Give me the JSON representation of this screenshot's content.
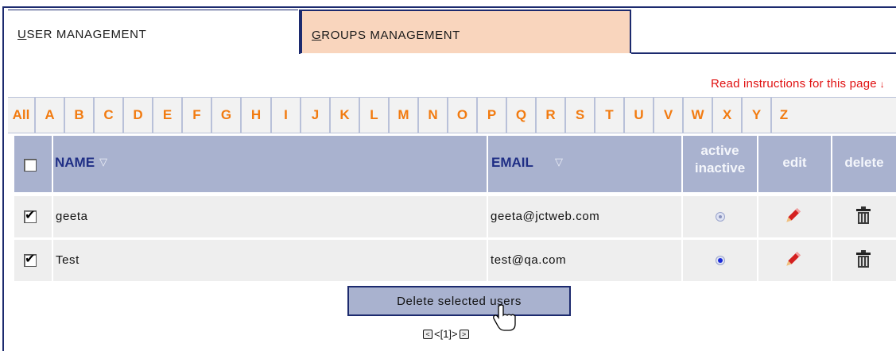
{
  "tabs": {
    "user": {
      "underlined": "U",
      "rest": "SER MANAGEMENT"
    },
    "groups": {
      "underlined": "G",
      "rest": "ROUPS MANAGEMENT"
    }
  },
  "instructions": {
    "label": "Read instructions for this page",
    "arrow": "↓"
  },
  "alphabet": [
    "All",
    "A",
    "B",
    "C",
    "D",
    "E",
    "F",
    "G",
    "H",
    "I",
    "J",
    "K",
    "L",
    "M",
    "N",
    "O",
    "P",
    "Q",
    "R",
    "S",
    "T",
    "U",
    "V",
    "W",
    "X",
    "Y",
    "Z"
  ],
  "table": {
    "headers": {
      "name": "NAME",
      "email": "EMAIL",
      "active_line1": "active",
      "active_line2": "inactive",
      "edit": "edit",
      "delete": "delete",
      "sort_arrow": "▽"
    },
    "rows": [
      {
        "name": "geeta",
        "email": "geeta@jctweb.com",
        "checked": true,
        "active": false
      },
      {
        "name": "Test",
        "email": "test@qa.com",
        "checked": true,
        "active": true
      }
    ]
  },
  "actions": {
    "delete_selected": "Delete selected users"
  },
  "pager": {
    "prev": "<",
    "pages": "<[1]>",
    "next": ">"
  },
  "colors": {
    "accent": "#1c2a6e",
    "header_bg": "#a9b2cf",
    "alpha_letter": "#f27b10",
    "instructions": "#e01010",
    "groups_tab": "#f9d5bd"
  }
}
